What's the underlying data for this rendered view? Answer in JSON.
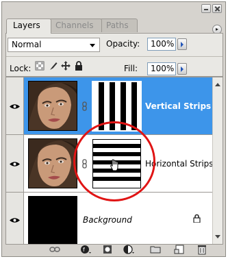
{
  "tabs": [
    {
      "label": "Layers",
      "active": true
    },
    {
      "label": "Channels",
      "active": false
    },
    {
      "label": "Paths",
      "active": false
    }
  ],
  "controls": {
    "blend_mode": "Normal",
    "opacity_label": "Opacity:",
    "opacity_value": "100%",
    "lock_label": "Lock:",
    "fill_label": "Fill:",
    "fill_value": "100%"
  },
  "layers": [
    {
      "name": "Vertical Strips",
      "selected": true,
      "visible": true,
      "mask": "vertical-strips"
    },
    {
      "name": "Horizontal Strips",
      "selected": false,
      "visible": true,
      "mask": "horizontal-strips"
    },
    {
      "name": "Background",
      "selected": false,
      "visible": true,
      "locked": true
    }
  ],
  "icons": [
    "minimize-icon",
    "close-icon",
    "panel-menu-icon",
    "lock-transparency-icon",
    "lock-paint-icon",
    "lock-move-icon",
    "lock-all-icon",
    "eye-icon",
    "link-icon",
    "hand-cursor-icon",
    "fx-icon",
    "add-mask-icon",
    "adjustment-layer-icon",
    "new-group-icon",
    "new-layer-icon",
    "trash-icon"
  ],
  "colors": {
    "selection": "#3d95ea",
    "annotation_circle": "#e01414",
    "panel_bg": "#d6d3ce"
  }
}
